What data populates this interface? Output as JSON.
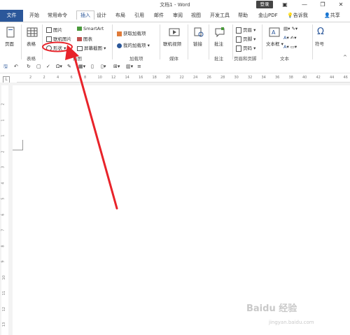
{
  "window": {
    "title": "文档1 - Word",
    "login": "登录",
    "minimize": "—",
    "restore": "❐",
    "close": "✕"
  },
  "tabs": [
    "文件",
    "开始",
    "常用命令",
    "插入",
    "设计",
    "布局",
    "引用",
    "邮件",
    "审阅",
    "视图",
    "开发工具",
    "帮助",
    "金山PDF",
    "告诉我",
    "共享"
  ],
  "ribbon": {
    "page": "页面",
    "table": "表格",
    "picture": "图片",
    "online_picture": "联机图片",
    "shape": "形状",
    "smartart": "SmartArt",
    "chart": "图表",
    "screenshot": "屏幕截图",
    "get_addins": "获取加载项",
    "my_addins": "我的加载项",
    "online_video": "联机视频",
    "link": "链接",
    "comment": "批注",
    "header": "页眉",
    "footer": "页脚",
    "page_number": "页码",
    "textbox": "文本框",
    "symbol": "符号",
    "groups": {
      "table": "表格",
      "illustrations": "插图",
      "addins": "加载项",
      "media": "媒体",
      "comments": "批注",
      "header_footer": "页眉和页脚",
      "text": "文本"
    }
  },
  "ruler": {
    "h_ticks": [
      "2",
      "2",
      "4",
      "6",
      "8",
      "10",
      "12",
      "14",
      "16",
      "18",
      "20",
      "22",
      "24",
      "26",
      "28",
      "30",
      "32",
      "34",
      "36",
      "38",
      "40",
      "42",
      "44",
      "46"
    ],
    "v_ticks": [
      "2",
      "1",
      "1",
      "2",
      "3",
      "4",
      "5",
      "6",
      "7",
      "8",
      "9",
      "10",
      "11",
      "12",
      "13"
    ]
  },
  "watermark": {
    "brand": "Baidu 经验",
    "url": "jingyan.baidu.com"
  },
  "colors": {
    "accent": "#2b579a",
    "arrow": "#e8232a"
  }
}
